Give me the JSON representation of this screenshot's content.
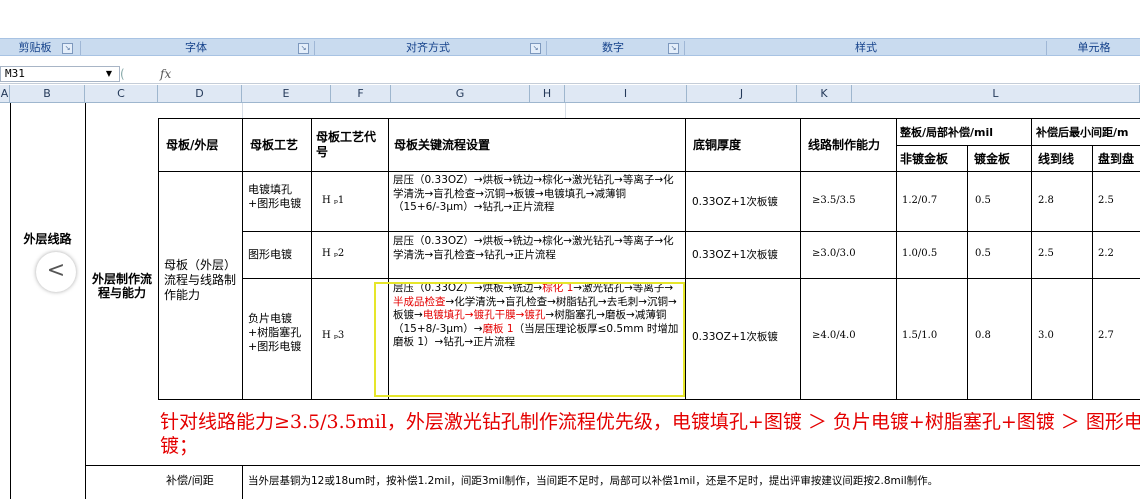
{
  "ribbon": {
    "groups": [
      "剪贴板",
      "字体",
      "对齐方式",
      "数字",
      "样式",
      "单元格"
    ]
  },
  "formula_bar": {
    "name_box": "M31",
    "fx_label": "fx",
    "value": ""
  },
  "columns": [
    "A",
    "B",
    "C",
    "D",
    "E",
    "F",
    "G",
    "H",
    "I",
    "J",
    "K",
    "L"
  ],
  "sheet": {
    "b_label": "外层线路",
    "c_label": "外层制作流程与能力",
    "headers": {
      "d": "母板/外层",
      "e": "母板工艺",
      "f": "母板工艺代号",
      "g": "母板关键流程设置",
      "j": "底铜厚度",
      "k": "线路制作能力",
      "l1": "整板/局部补偿/mil",
      "l2": "补偿后最小间距/m",
      "sub1": "非镀金板",
      "sub2": "镀金板",
      "sub3": "线到线",
      "sub4": "盘到盘"
    },
    "d_merged": "母板（外层）流程与线路制作能力",
    "rows": [
      {
        "process": "电镀填孔+图形电镀",
        "code": "H ₚ1",
        "flow": "层压（0.33OZ）→烘板→铣边→棕化→激光钻孔→等离子→化学清洗→盲孔检查→沉铜→板镀→电镀填孔→减薄铜（15+6/-3μm）→钻孔→正片流程",
        "copper": "0.33OZ+1次板镀",
        "capability": "≥3.5/3.5",
        "comp_nongold": "1.2/0.7",
        "comp_gold": "0.5",
        "line": "2.8",
        "pad": "2.5"
      },
      {
        "process": "图形电镀",
        "code": "H ₚ2",
        "flow": "层压（0.33OZ）→烘板→铣边→棕化→激光钻孔→等离子→化学清洗→盲孔检查→钻孔→正片流程",
        "copper": "0.33OZ+1次板镀",
        "capability": "≥3.0/3.0",
        "comp_nongold": "1.0/0.5",
        "comp_gold": "0.5",
        "line": "2.5",
        "pad": "2.2"
      },
      {
        "process": "负片电镀+树脂塞孔+图形电镀",
        "code": "H ₚ3",
        "flow_parts": [
          {
            "t": "层压（0.33OZ）→烘板→铣边→",
            "red": false
          },
          {
            "t": "棕化 1",
            "red": true
          },
          {
            "t": "→激光钻孔→等离子→",
            "red": false
          },
          {
            "t": "半成品检查",
            "red": true
          },
          {
            "t": "→化学清洗→盲孔检查→树脂钻孔→去毛刺→沉铜→板镀→",
            "red": false
          },
          {
            "t": "电镀填孔→镀孔干膜→镀孔",
            "red": true
          },
          {
            "t": "→树脂塞孔→磨板→减薄铜（15+8/-3μm）→",
            "red": false
          },
          {
            "t": "磨板 1",
            "red": true
          },
          {
            "t": "（当层压理论板厚≤0.5mm 时增加磨板 1）→钻孔→正片流程",
            "red": false
          }
        ],
        "copper": "0.33OZ+1次板镀",
        "capability": "≥4.0/4.0",
        "comp_nongold": "1.5/1.0",
        "comp_gold": "0.8",
        "line": "3.0",
        "pad": "2.7"
      }
    ],
    "note": "针对线路能力≥3.5/3.5mil，外层激光钻孔制作流程优先级，电镀填孔+图镀 ＞ 负片电镀+树脂塞孔+图镀 ＞ 图形电镀；",
    "bottom_label": "补偿/间距",
    "bottom_text": "当外层基铜为12或18um时，按补偿1.2mil，间距3mil制作，当间距不足时，局部可以补偿1mil，还是不足时，提出评审按建议间距按2.8mil制作。"
  },
  "nav": {
    "symbol": "<"
  },
  "colors": {
    "ribbon_group_bg": "#c9dbef",
    "highlight_border": "#e6e62a",
    "note_red": "#e40000"
  }
}
